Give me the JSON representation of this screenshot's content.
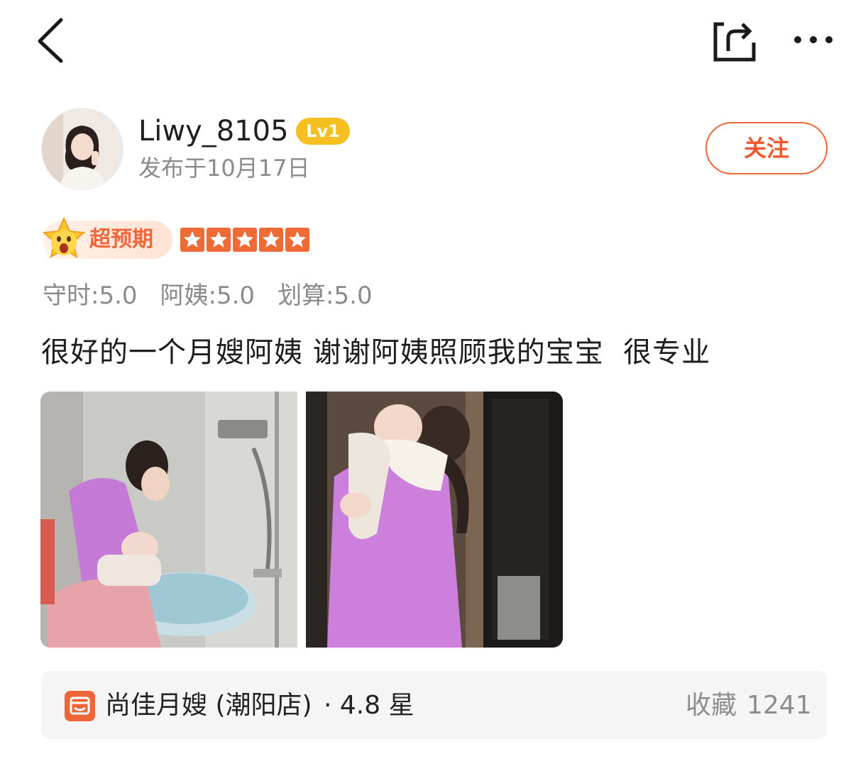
{
  "author": {
    "username": "Liwy_8105",
    "level": "Lv1",
    "post_date": "发布于10月17日"
  },
  "actions": {
    "follow_label": "关注"
  },
  "rating": {
    "overall_label": "超预期",
    "stars": 5,
    "max_stars": 5,
    "scores": [
      "守时:5.0",
      "阿姨:5.0",
      "划算:5.0"
    ],
    "accent_color": "#f06a35"
  },
  "review": {
    "text": "很好的一个月嫂阿姨 谢谢阿姨照顾我的宝宝  很专业"
  },
  "shop": {
    "name": "尚佳月嫂 (潮阳店)",
    "rating": "· 4.8 星",
    "favorite_label": "收藏",
    "favorite_count": "1241"
  }
}
